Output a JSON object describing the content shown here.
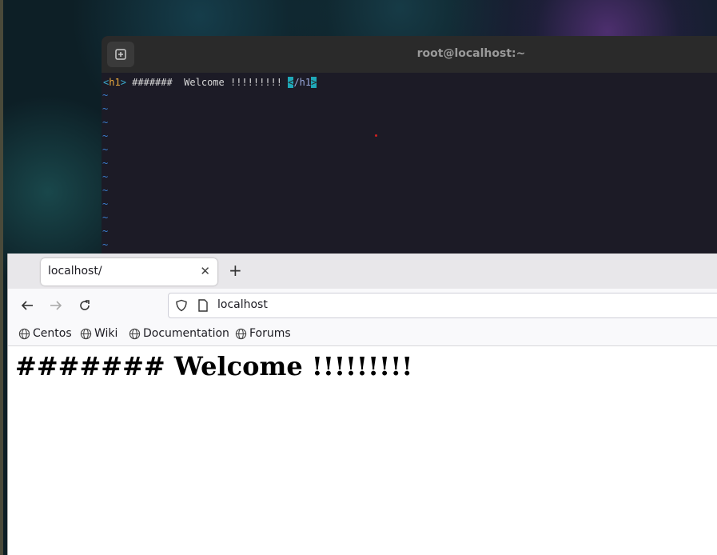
{
  "terminal": {
    "title": "root@localhost:~",
    "code": {
      "open_bracket": "<",
      "open_tag": "h1",
      "close_bracket": ">",
      "text": " #######  Welcome !!!!!!!!! ",
      "close_open": "<",
      "close_slash_tag": "/h1",
      "close_end": ">"
    },
    "tilde_lines": "~\n~\n~\n~\n~\n~\n~\n~\n~\n~\n~\n~"
  },
  "browser": {
    "tab_title": "localhost/",
    "tab_close": "✕",
    "new_tab": "+",
    "url": "localhost",
    "bookmarks": [
      "Centos",
      "Wiki",
      "Documentation",
      "Forums"
    ],
    "page_heading": "####### Welcome !!!!!!!!!"
  },
  "colors": {
    "terminal_bg": "#1c1b26",
    "cursor_highlight": "#1fa8b8",
    "tag_color": "#e8a93e",
    "bracket_color": "#3aa7c9"
  }
}
